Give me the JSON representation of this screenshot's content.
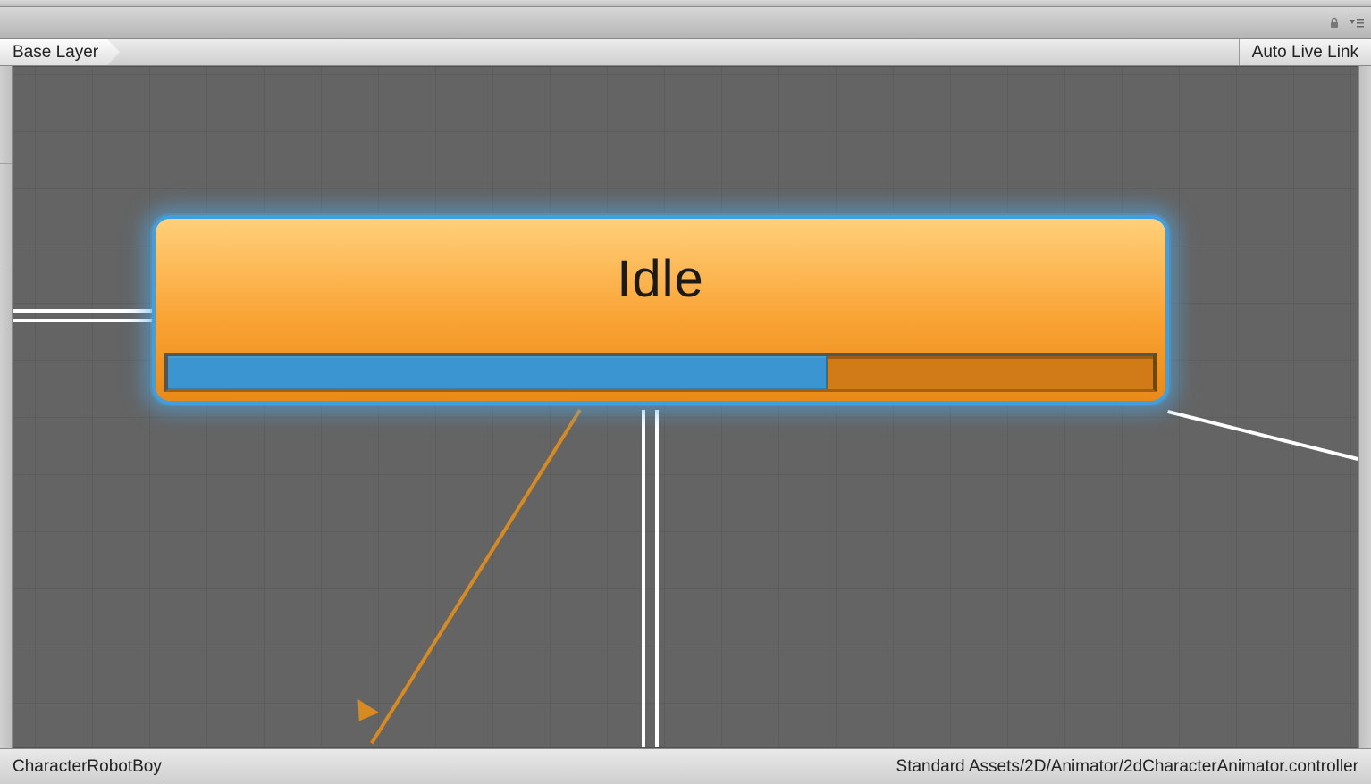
{
  "breadcrumb": {
    "layer_label": "Base Layer"
  },
  "toolbar": {
    "auto_live_link_label": "Auto Live Link"
  },
  "node": {
    "label": "Idle",
    "progress_percent": 67,
    "colors": {
      "fill_top": "#ffd07a",
      "fill_bottom": "#e98a18",
      "selected_border": "#3f9fe0",
      "progress_fill": "#3a95d0",
      "progress_track": "#d07a18"
    }
  },
  "status": {
    "left": "CharacterRobotBoy",
    "right": "Standard Assets/2D/Animator/2dCharacterAnimator.controller"
  }
}
